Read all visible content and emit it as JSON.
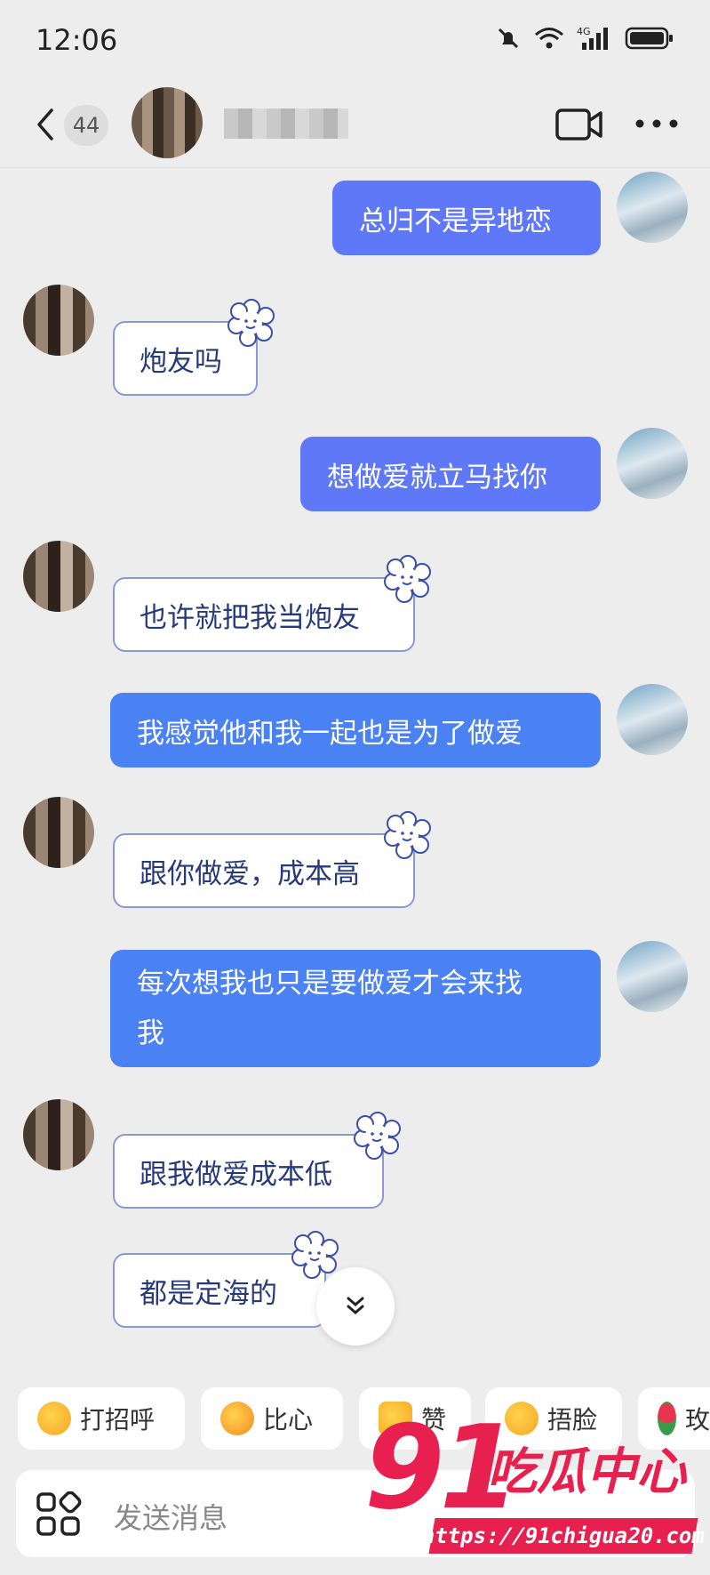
{
  "status_bar": {
    "time": "12:06"
  },
  "header": {
    "unread_count": "44"
  },
  "messages": [
    {
      "side": "me",
      "text": "总归不是异地恋"
    },
    {
      "side": "other",
      "text": "炮友吗"
    },
    {
      "side": "me",
      "text": "想做爱就立马找你"
    },
    {
      "side": "other",
      "text": "也许就把我当炮友"
    },
    {
      "side": "me",
      "text": "我感觉他和我一起也是为了做爱"
    },
    {
      "side": "other",
      "text": "跟你做爱，成本高"
    },
    {
      "side": "me",
      "text_line1": "每次想我也只是要做爱才会来找",
      "text_line2": "我"
    },
    {
      "side": "other",
      "text": "跟我做爱成本低"
    },
    {
      "side": "other",
      "text": "都是定海的"
    }
  ],
  "quick_replies": [
    {
      "label": "打招呼",
      "icon": "wave-emoji-icon"
    },
    {
      "label": "比心",
      "icon": "heart-hands-emoji-icon"
    },
    {
      "label": "赞",
      "icon": "thumbs-up-emoji-icon"
    },
    {
      "label": "捂脸",
      "icon": "facepalm-emoji-icon"
    },
    {
      "label": "玫",
      "icon": "rose-emoji-icon"
    }
  ],
  "input": {
    "placeholder": "发送消息"
  },
  "watermark": {
    "number": "91",
    "text": "吃瓜中心",
    "url": "https://91chigua20.com"
  },
  "colors": {
    "my_bubble": "#5e78f7",
    "my_bubble_alt": "#4a82f3",
    "other_text": "#263a7a",
    "watermark": "#e8204f"
  }
}
